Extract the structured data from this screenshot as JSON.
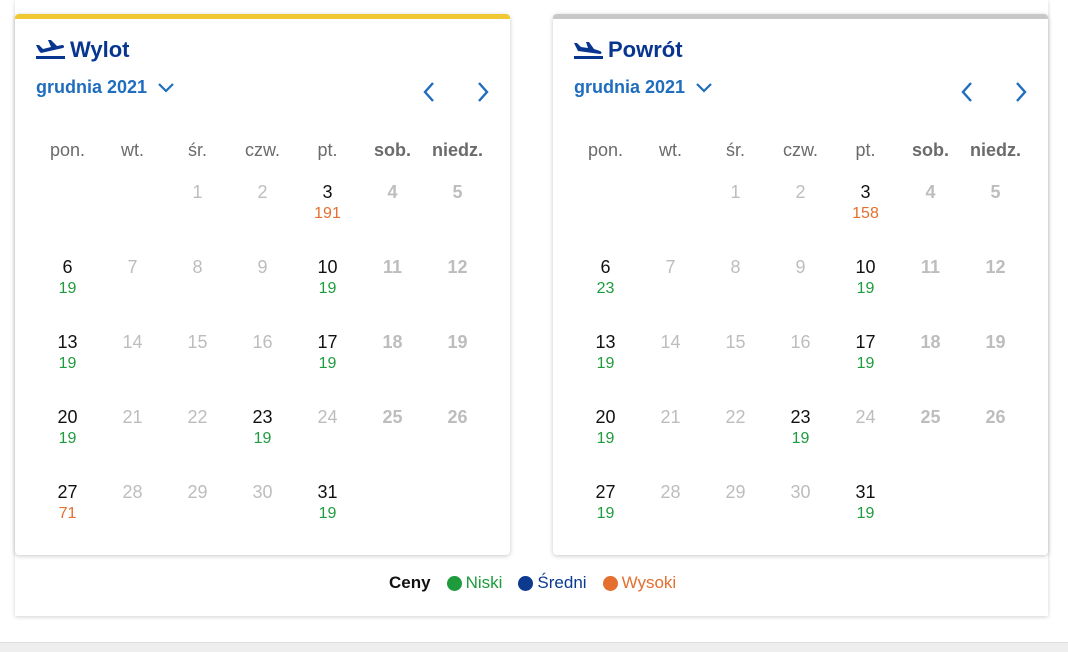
{
  "colors": {
    "low": "#1e9b3c",
    "medium": "#0b3a8f",
    "high": "#e46f2e",
    "title": "#073590",
    "accent": "#1f6dbf",
    "departure_bar": "#f0c831",
    "return_bar": "#c8c8c8"
  },
  "weekdays": [
    "pon.",
    "wt.",
    "śr.",
    "czw.",
    "pt.",
    "sob.",
    "niedz."
  ],
  "calendars": [
    {
      "title": "Wylot",
      "icon": "plane-takeoff-icon",
      "month": "grudnia 2021",
      "days": [
        {
          "n": "",
          "s": "empty"
        },
        {
          "n": "",
          "s": "empty"
        },
        {
          "n": "1",
          "s": "dis"
        },
        {
          "n": "2",
          "s": "dis"
        },
        {
          "n": "3",
          "s": "active",
          "p": "191",
          "t": "high"
        },
        {
          "n": "4",
          "s": "we"
        },
        {
          "n": "5",
          "s": "we"
        },
        {
          "n": "6",
          "s": "active",
          "p": "19",
          "t": "low"
        },
        {
          "n": "7",
          "s": "dis"
        },
        {
          "n": "8",
          "s": "dis"
        },
        {
          "n": "9",
          "s": "dis"
        },
        {
          "n": "10",
          "s": "active",
          "p": "19",
          "t": "low"
        },
        {
          "n": "11",
          "s": "we"
        },
        {
          "n": "12",
          "s": "we"
        },
        {
          "n": "13",
          "s": "active",
          "p": "19",
          "t": "low"
        },
        {
          "n": "14",
          "s": "dis"
        },
        {
          "n": "15",
          "s": "dis"
        },
        {
          "n": "16",
          "s": "dis"
        },
        {
          "n": "17",
          "s": "active",
          "p": "19",
          "t": "low"
        },
        {
          "n": "18",
          "s": "we"
        },
        {
          "n": "19",
          "s": "we"
        },
        {
          "n": "20",
          "s": "active",
          "p": "19",
          "t": "low"
        },
        {
          "n": "21",
          "s": "dis"
        },
        {
          "n": "22",
          "s": "dis"
        },
        {
          "n": "23",
          "s": "active",
          "p": "19",
          "t": "low"
        },
        {
          "n": "24",
          "s": "dis"
        },
        {
          "n": "25",
          "s": "we"
        },
        {
          "n": "26",
          "s": "we"
        },
        {
          "n": "27",
          "s": "active",
          "p": "71",
          "t": "high"
        },
        {
          "n": "28",
          "s": "dis"
        },
        {
          "n": "29",
          "s": "dis"
        },
        {
          "n": "30",
          "s": "dis"
        },
        {
          "n": "31",
          "s": "active",
          "p": "19",
          "t": "low"
        }
      ]
    },
    {
      "title": "Powrót",
      "icon": "plane-landing-icon",
      "month": "grudnia 2021",
      "days": [
        {
          "n": "",
          "s": "empty"
        },
        {
          "n": "",
          "s": "empty"
        },
        {
          "n": "1",
          "s": "dis"
        },
        {
          "n": "2",
          "s": "dis"
        },
        {
          "n": "3",
          "s": "active",
          "p": "158",
          "t": "high"
        },
        {
          "n": "4",
          "s": "we"
        },
        {
          "n": "5",
          "s": "we"
        },
        {
          "n": "6",
          "s": "active",
          "p": "23",
          "t": "low"
        },
        {
          "n": "7",
          "s": "dis"
        },
        {
          "n": "8",
          "s": "dis"
        },
        {
          "n": "9",
          "s": "dis"
        },
        {
          "n": "10",
          "s": "active",
          "p": "19",
          "t": "low"
        },
        {
          "n": "11",
          "s": "we"
        },
        {
          "n": "12",
          "s": "we"
        },
        {
          "n": "13",
          "s": "active",
          "p": "19",
          "t": "low"
        },
        {
          "n": "14",
          "s": "dis"
        },
        {
          "n": "15",
          "s": "dis"
        },
        {
          "n": "16",
          "s": "dis"
        },
        {
          "n": "17",
          "s": "active",
          "p": "19",
          "t": "low"
        },
        {
          "n": "18",
          "s": "we"
        },
        {
          "n": "19",
          "s": "we"
        },
        {
          "n": "20",
          "s": "active",
          "p": "19",
          "t": "low"
        },
        {
          "n": "21",
          "s": "dis"
        },
        {
          "n": "22",
          "s": "dis"
        },
        {
          "n": "23",
          "s": "active",
          "p": "19",
          "t": "low"
        },
        {
          "n": "24",
          "s": "dis"
        },
        {
          "n": "25",
          "s": "we"
        },
        {
          "n": "26",
          "s": "we"
        },
        {
          "n": "27",
          "s": "active",
          "p": "19",
          "t": "low"
        },
        {
          "n": "28",
          "s": "dis"
        },
        {
          "n": "29",
          "s": "dis"
        },
        {
          "n": "30",
          "s": "dis"
        },
        {
          "n": "31",
          "s": "active",
          "p": "19",
          "t": "low"
        }
      ]
    }
  ],
  "legend": {
    "label": "Ceny",
    "items": [
      {
        "label": "Niski",
        "color": "#1e9b3c"
      },
      {
        "label": "Średni",
        "color": "#0b3a8f"
      },
      {
        "label": "Wysoki",
        "color": "#e46f2e"
      }
    ]
  }
}
